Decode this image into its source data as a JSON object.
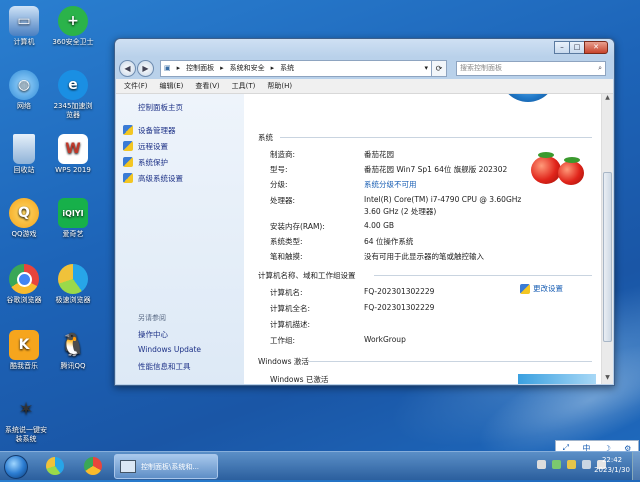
{
  "desktop": {
    "icons": [
      {
        "label": "计算机",
        "icon": "computer-icon",
        "color": "#4a7fc1"
      },
      {
        "label": "360安全卫士",
        "icon": "360-plus-icon",
        "color": "#2bb34a"
      },
      {
        "label": "网络",
        "icon": "network-globe-icon",
        "color": "#2e8ad6"
      },
      {
        "label": "2345加速浏览器",
        "icon": "browser-e-icon",
        "color": "#1a8fe3"
      },
      {
        "label": "回收站",
        "icon": "recycle-bin-icon",
        "color": "#8fb3d8"
      },
      {
        "label": "WPS 2019",
        "icon": "wps-icon",
        "color": "#ffffff"
      },
      {
        "label": "QQ游戏",
        "icon": "qq-game-icon",
        "color": "#f3a21a"
      },
      {
        "label": "爱奇艺",
        "icon": "iqiyi-icon",
        "color": "#17b04a"
      },
      {
        "label": "谷歌浏览器",
        "icon": "chrome-icon",
        "color": "#e8453c"
      },
      {
        "label": "极速浏览器",
        "icon": "fast-browser-icon",
        "color": "#27a5e8"
      },
      {
        "label": "酷我音乐",
        "icon": "kuwo-music-icon",
        "color": "#f6a51d"
      },
      {
        "label": "腾讯QQ",
        "icon": "qq-penguin-icon",
        "color": "#111111"
      },
      {
        "label": "系统说一键安装系统",
        "icon": "rabbit-installer-icon",
        "color": "#555555"
      }
    ]
  },
  "window": {
    "title": "",
    "breadcrumb": [
      "控制面板",
      "系统和安全",
      "系统"
    ],
    "search_placeholder": "搜索控制面板",
    "menu": [
      "文件(F)",
      "编辑(E)",
      "查看(V)",
      "工具(T)",
      "帮助(H)"
    ],
    "sidebar": {
      "home": "控制面板主页",
      "links": [
        "设备管理器",
        "远程设置",
        "系统保护",
        "高级系统设置"
      ],
      "see_also_title": "另请参阅",
      "see_also": [
        "操作中心",
        "Windows Update",
        "性能信息和工具"
      ]
    },
    "system": {
      "section_title": "系统",
      "rows": [
        {
          "label": "制造商:",
          "value": "番茄花园"
        },
        {
          "label": "型号:",
          "value": "番茄花园 Win7 Sp1 64位 旗舰版 202302"
        },
        {
          "label": "分级:",
          "value": "系统分级不可用",
          "link": true
        },
        {
          "label": "处理器:",
          "value": "Intel(R) Core(TM) i7-4790 CPU @ 3.60GHz",
          "value2": "3.60 GHz  (2 处理器)"
        },
        {
          "label": "安装内存(RAM):",
          "value": "4.00 GB"
        },
        {
          "label": "系统类型:",
          "value": "64 位操作系统"
        },
        {
          "label": "笔和触摸:",
          "value": "没有可用于此显示器的笔或触控输入"
        }
      ]
    },
    "computer": {
      "section_title": "计算机名称、域和工作组设置",
      "change_label": "更改设置",
      "rows": [
        {
          "label": "计算机名:",
          "value": "FQ-202301302229"
        },
        {
          "label": "计算机全名:",
          "value": "FQ-202301302229"
        },
        {
          "label": "计算机描述:",
          "value": ""
        },
        {
          "label": "工作组:",
          "value": "WorkGroup"
        }
      ]
    },
    "activation": {
      "section_title": "Windows 激活",
      "status": "Windows 已激活"
    }
  },
  "taskbar": {
    "task_label": "控制面板\\系统和...",
    "time": "22:42",
    "date": "2023/1/30",
    "ime": [
      "中",
      "☽",
      "⚙"
    ]
  }
}
